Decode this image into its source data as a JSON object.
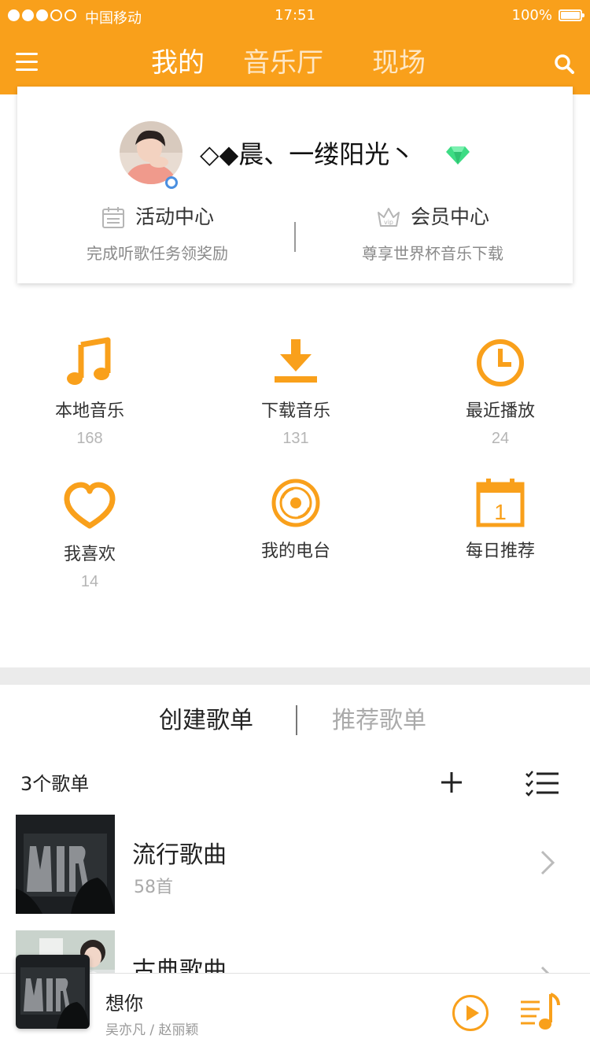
{
  "status_bar": {
    "carrier": "中国移动",
    "time": "17:51",
    "battery": "100%"
  },
  "nav": {
    "tabs": [
      {
        "label": "我的"
      },
      {
        "label": "音乐厅"
      },
      {
        "label": "现场"
      }
    ]
  },
  "profile": {
    "username": "◇◆晨、一缕阳光丶",
    "activity": {
      "title": "活动中心",
      "subtitle": "完成听歌任务领奖励"
    },
    "vip": {
      "title": "会员中心",
      "subtitle": "尊享世界杯音乐下载",
      "badge_text": "vip"
    }
  },
  "shortcuts": [
    {
      "label": "本地音乐",
      "count": "168",
      "icon": "music-note-icon"
    },
    {
      "label": "下载音乐",
      "count": "131",
      "icon": "download-icon"
    },
    {
      "label": "最近播放",
      "count": "24",
      "icon": "clock-icon"
    },
    {
      "label": "我喜欢",
      "count": "14",
      "icon": "heart-icon"
    },
    {
      "label": "我的电台",
      "icon": "radio-disc-icon"
    },
    {
      "label": "每日推荐",
      "icon": "calendar-icon",
      "calendar_day": "1"
    }
  ],
  "playlists": {
    "tabs": {
      "created": "创建歌单",
      "recommended": "推荐歌单"
    },
    "count_label": "3个歌单",
    "items": [
      {
        "name": "流行歌曲",
        "count": "58首"
      },
      {
        "name": "古典歌曲"
      }
    ]
  },
  "player": {
    "title": "想你",
    "artist": "吴亦凡 / 赵丽颖"
  },
  "colors": {
    "accent": "#f9a01b",
    "text": "#222222",
    "muted": "#aaaaaa",
    "gem": "#3ddc84"
  }
}
